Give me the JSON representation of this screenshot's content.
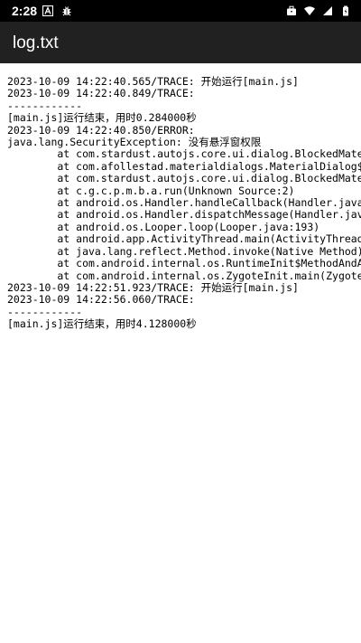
{
  "status_bar": {
    "time": "2:28",
    "left_icons": [
      "font-a-icon",
      "bug-icon"
    ],
    "right_icons": [
      "briefcase-icon",
      "wifi-icon",
      "signal-icon",
      "battery-icon"
    ]
  },
  "app_bar": {
    "title": "log.txt"
  },
  "log": {
    "lines": [
      "2023-10-09 14:22:40.565/TRACE: 开始运行[main.js]",
      "2023-10-09 14:22:40.849/TRACE:",
      "------------",
      "[main.js]运行结束，用时0.284000秒",
      "2023-10-09 14:22:40.850/ERROR:",
      "java.lang.SecurityException: 没有悬浮窗权限",
      "        at com.stardust.autojs.core.ui.dialog.BlockedMate",
      "        at com.afollestad.materialdialogs.MaterialDialog$",
      "        at com.stardust.autojs.core.ui.dialog.BlockedMate",
      "        at c.g.c.p.m.b.a.run(Unknown Source:2)",
      "        at android.os.Handler.handleCallback(Handler.java",
      "        at android.os.Handler.dispatchMessage(Handler.jav",
      "        at android.os.Looper.loop(Looper.java:193)",
      "        at android.app.ActivityThread.main(ActivityThread",
      "        at java.lang.reflect.Method.invoke(Native Method)",
      "        at com.android.internal.os.RuntimeInit$MethodAndA",
      "        at com.android.internal.os.ZygoteInit.main(Zygote",
      "2023-10-09 14:22:51.923/TRACE: 开始运行[main.js]",
      "2023-10-09 14:22:56.060/TRACE:",
      "------------",
      "[main.js]运行结束，用时4.128000秒"
    ]
  }
}
